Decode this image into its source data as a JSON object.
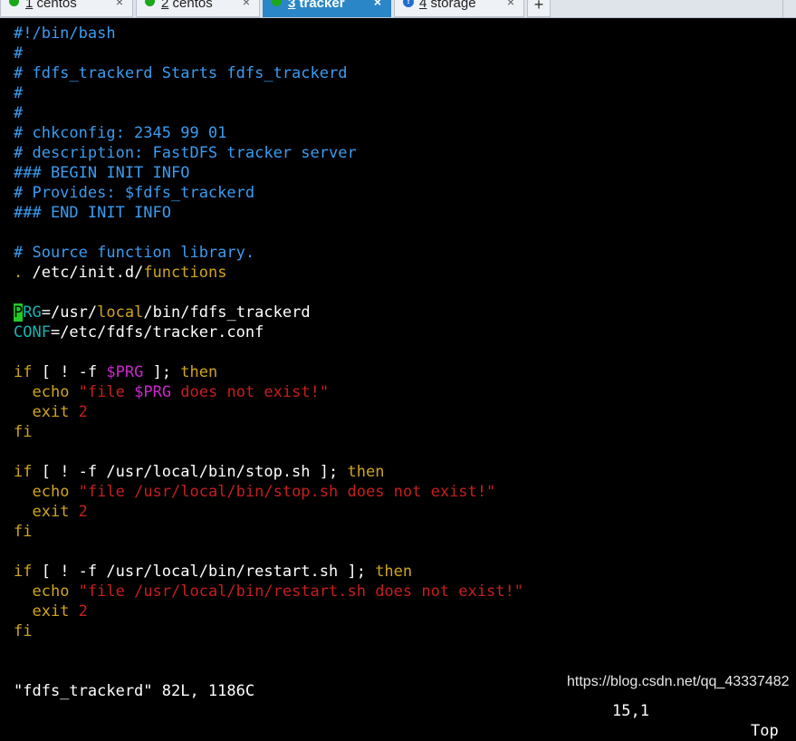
{
  "tabs": [
    {
      "number": "1",
      "label": " centos",
      "close": "×",
      "icon": "green-dot-icon"
    },
    {
      "number": "2",
      "label": " centos",
      "close": "×",
      "icon": "green-dot-icon"
    },
    {
      "number": "3",
      "label": " tracker",
      "close": "×",
      "icon": "green-dot-icon",
      "active": true
    },
    {
      "number": "4",
      "label": " storage",
      "close": "×",
      "icon": "info-icon"
    }
  ],
  "new_tab": "+",
  "editor": {
    "lines": [
      [
        {
          "t": "#!/bin/bash",
          "c": "c-cmt"
        }
      ],
      [
        {
          "t": "#",
          "c": "c-cmt"
        }
      ],
      [
        {
          "t": "# fdfs_trackerd Starts fdfs_trackerd",
          "c": "c-cmt"
        }
      ],
      [
        {
          "t": "#",
          "c": "c-cmt"
        }
      ],
      [
        {
          "t": "#",
          "c": "c-cmt"
        }
      ],
      [
        {
          "t": "# chkconfig: 2345 99 01",
          "c": "c-cmt"
        }
      ],
      [
        {
          "t": "# description: FastDFS tracker server",
          "c": "c-cmt"
        }
      ],
      [
        {
          "t": "### BEGIN INIT INFO",
          "c": "c-cmt"
        }
      ],
      [
        {
          "t": "# Provides: $fdfs_trackerd",
          "c": "c-cmt"
        }
      ],
      [
        {
          "t": "### END INIT INFO",
          "c": "c-cmt"
        }
      ],
      [],
      [
        {
          "t": "# Source function library.",
          "c": "c-cmt"
        }
      ],
      [
        {
          "t": ".",
          "c": "c-dot"
        },
        {
          "t": " /etc/init.d/"
        },
        {
          "t": "functions",
          "c": "c-kw"
        }
      ],
      [],
      [
        {
          "t": "P",
          "c": "cursor"
        },
        {
          "t": "RG",
          "c": "c-cyan"
        },
        {
          "t": "=/usr/"
        },
        {
          "t": "local",
          "c": "c-kw"
        },
        {
          "t": "/bin/fdfs_trackerd"
        }
      ],
      [
        {
          "t": "CONF",
          "c": "c-cyan"
        },
        {
          "t": "=/etc/fdfs/tracker.conf"
        }
      ],
      [],
      [
        {
          "t": "if",
          "c": "c-kw"
        },
        {
          "t": " [ ! -f "
        },
        {
          "t": "$PRG",
          "c": "c-var"
        },
        {
          "t": " ]; "
        },
        {
          "t": "then",
          "c": "c-kw"
        }
      ],
      [
        {
          "t": "  "
        },
        {
          "t": "echo",
          "c": "c-kw"
        },
        {
          "t": " \"",
          "c": "c-str"
        },
        {
          "t": "file ",
          "c": "c-str"
        },
        {
          "t": "$PRG",
          "c": "c-var"
        },
        {
          "t": " does not exist!\"",
          "c": "c-str"
        }
      ],
      [
        {
          "t": "  "
        },
        {
          "t": "exit",
          "c": "c-kw"
        },
        {
          "t": " 2",
          "c": "c-str"
        }
      ],
      [
        {
          "t": "fi",
          "c": "c-kw"
        }
      ],
      [],
      [
        {
          "t": "if",
          "c": "c-kw"
        },
        {
          "t": " [ ! -f /usr/local/bin/stop.sh ]; "
        },
        {
          "t": "then",
          "c": "c-kw"
        }
      ],
      [
        {
          "t": "  "
        },
        {
          "t": "echo",
          "c": "c-kw"
        },
        {
          "t": " \"file /usr/local/bin/stop.sh does not exist!\"",
          "c": "c-str"
        }
      ],
      [
        {
          "t": "  "
        },
        {
          "t": "exit",
          "c": "c-kw"
        },
        {
          "t": " 2",
          "c": "c-str"
        }
      ],
      [
        {
          "t": "fi",
          "c": "c-kw"
        }
      ],
      [],
      [
        {
          "t": "if",
          "c": "c-kw"
        },
        {
          "t": " [ ! -f /usr/local/bin/restart.sh ]; "
        },
        {
          "t": "then",
          "c": "c-kw"
        }
      ],
      [
        {
          "t": "  "
        },
        {
          "t": "echo",
          "c": "c-kw"
        },
        {
          "t": " \"file /usr/local/bin/restart.sh does not exist!\"",
          "c": "c-str"
        }
      ],
      [
        {
          "t": "  "
        },
        {
          "t": "exit",
          "c": "c-kw"
        },
        {
          "t": " 2",
          "c": "c-str"
        }
      ],
      [
        {
          "t": "fi",
          "c": "c-kw"
        }
      ]
    ]
  },
  "status": {
    "message": "\"fdfs_trackerd\" 82L, 1186C",
    "position": "15,1",
    "scroll": "Top"
  },
  "watermark": "https://blog.csdn.net/qq_43337482",
  "colors": {
    "comment": "#3b9cf0",
    "keyword": "#d0a51c",
    "variable": "#cc27cc",
    "string": "#c81e1e",
    "identifier": "#18b3b3",
    "cursor": "#22cc22",
    "active_tab": "#2b86c8"
  }
}
